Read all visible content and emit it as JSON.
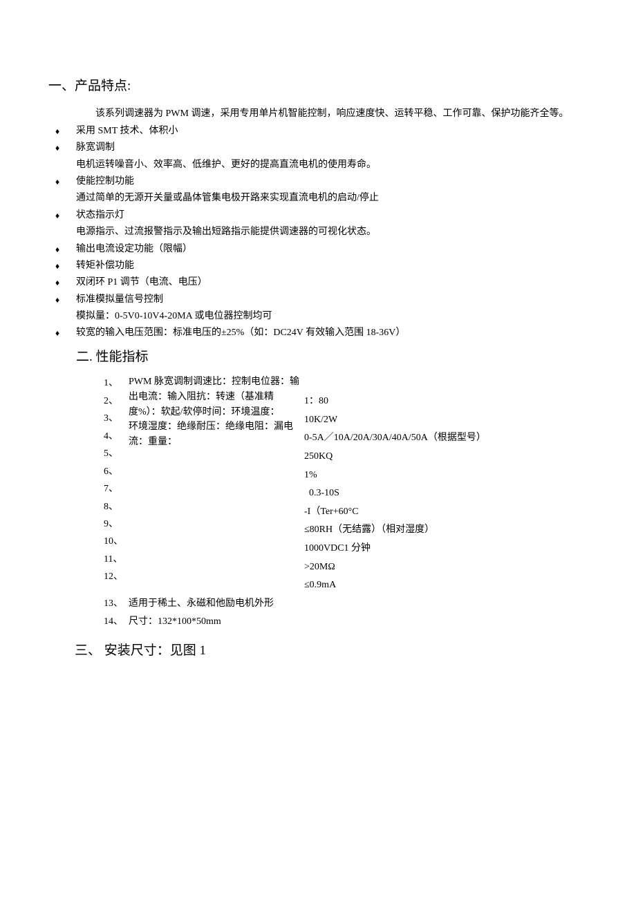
{
  "section1": {
    "heading": "一、产品特点:",
    "intro": "该系列调速器为 PWM 调速，采用专用单片机智能控制，响应速度快、运转平稳、工作可靠、保护功能齐全等。",
    "bullets": [
      {
        "main": "采用 SMT 技术、体积小"
      },
      {
        "main": "脉宽调制",
        "sub": "电机运转噪音小、效率高、低维护、更好的提高直流电机的使用寿命。"
      },
      {
        "main": "使能控制功能",
        "sub": "通过简单的无源开关量或晶体管集电极开路来实现直流电机的启动/停止"
      },
      {
        "main": "状态指示灯",
        "sub": "电源指示、过流报警指示及输出短路指示能提供调速器的可视化状态。"
      },
      {
        "main": "输出电流设定功能（限幅）"
      },
      {
        "main": "转矩补偿功能"
      },
      {
        "main": "双闭环 P1 调节（电流、电压）"
      },
      {
        "main": "标准模拟量信号控制",
        "sub": "模拟量：0-5V0-10V4-20MA 或电位器控制均可"
      },
      {
        "main": "较宽的输入电压范围：标准电压的±25%（如：DC24V 有效输入范围 18-36V）"
      }
    ]
  },
  "section2": {
    "heading": "二.  性能指标",
    "left_nums": [
      "1、",
      "2、",
      "3、",
      "4、",
      "5、",
      "6、",
      "7、",
      "8、",
      "9、",
      "10、",
      "11、",
      "12、"
    ],
    "left_labels_block": "PWM 脉宽调制调速比：控制电位器：输出电流：输入阻抗：转速（基准精度%）：软起/软停时间：环境温度：\n环境湿度：绝缘耐压：绝缘电阻：漏电流：重量：",
    "right_values": [
      "1：80",
      "10K/2W",
      "0-5A／10A/20A/30A/40A/50A（根据型号）",
      "250KQ",
      "1%",
      "  0.3-10S",
      "-I（Ter+60°C",
      "≤80RH（无结露）（相对湿度）",
      "1000VDC1 分钟",
      ">20MΩ",
      "≤0.9mA"
    ],
    "extra_rows": [
      {
        "num": "13、",
        "text": "适用于稀土、永磁和他励电机外形"
      },
      {
        "num": "14、",
        "text": "尺寸：132*100*50mm"
      }
    ]
  },
  "section3": {
    "heading": "三、 安装尺寸：见图 1"
  },
  "bullet_glyph": "♦"
}
